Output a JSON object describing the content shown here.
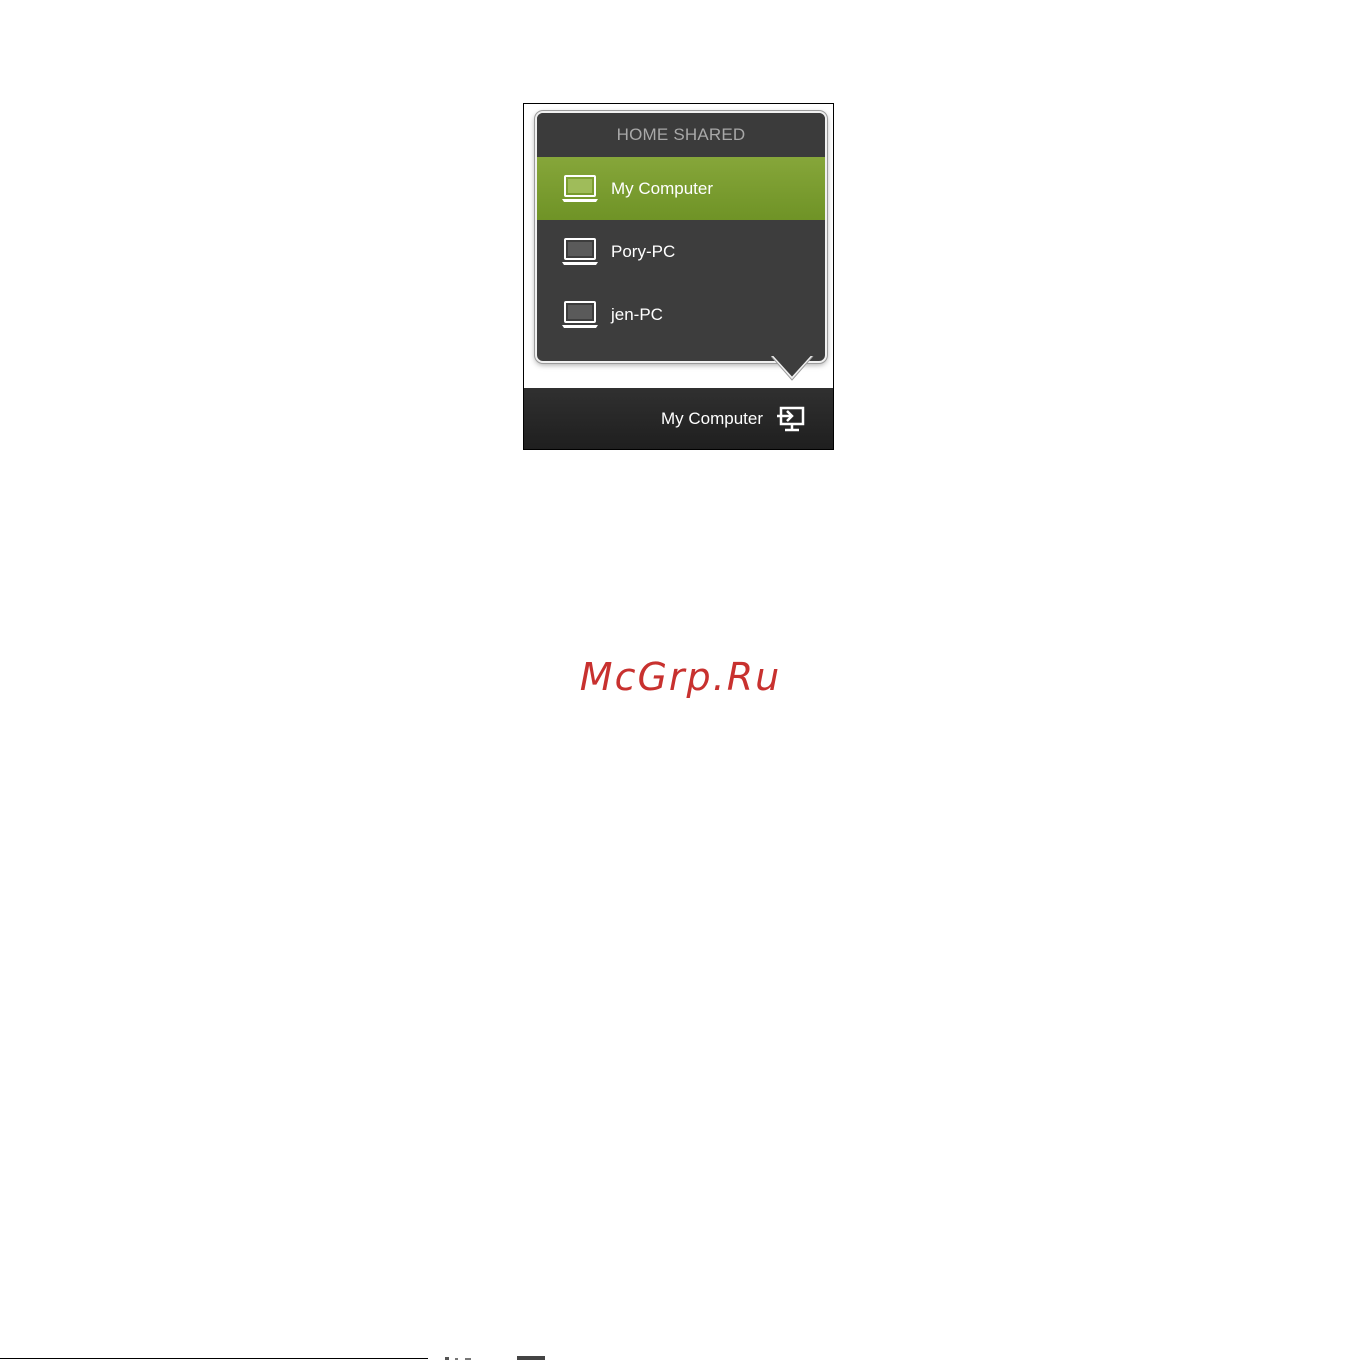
{
  "popup": {
    "header": "HOME SHARED",
    "items": [
      {
        "label": "My Computer",
        "selected": true,
        "icon": "laptop-icon"
      },
      {
        "label": "Pory-PC",
        "selected": false,
        "icon": "laptop-icon"
      },
      {
        "label": "jen-PC",
        "selected": false,
        "icon": "laptop-icon"
      }
    ]
  },
  "statusbar": {
    "current_device": "My Computer",
    "icon": "switch-device-icon"
  },
  "watermark": "McGrp.Ru",
  "colors": {
    "popup_bg": "#3d3d3d",
    "selected_green": "#7a9c2f",
    "header_text": "#a8a8a8",
    "statusbar_bg": "#262626",
    "watermark_red": "#c8312f"
  }
}
